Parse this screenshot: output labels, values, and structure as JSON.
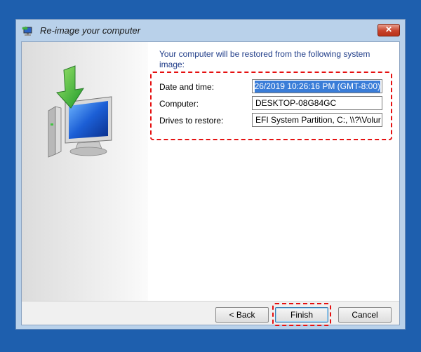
{
  "window": {
    "title": "Re-image your computer",
    "close_symbol": "✕"
  },
  "heading": "Your computer will be restored from the following system image:",
  "details": [
    {
      "label": "Date and time:",
      "value": "26/2019 10:26:16 PM (GMT-8:00)"
    },
    {
      "label": "Computer:",
      "value": "DESKTOP-08G84GC"
    },
    {
      "label": "Drives to restore:",
      "value": "EFI System Partition, C:, \\\\?\\Volur"
    }
  ],
  "buttons": {
    "back": "< Back",
    "finish": "Finish",
    "cancel": "Cancel"
  },
  "colors": {
    "desktop": "#1e5fae",
    "highlight": "#e51010",
    "heading": "#1f3c88"
  },
  "icons": {
    "title": "restore-computer-icon",
    "art": "computer-restore-arrow-icon"
  }
}
